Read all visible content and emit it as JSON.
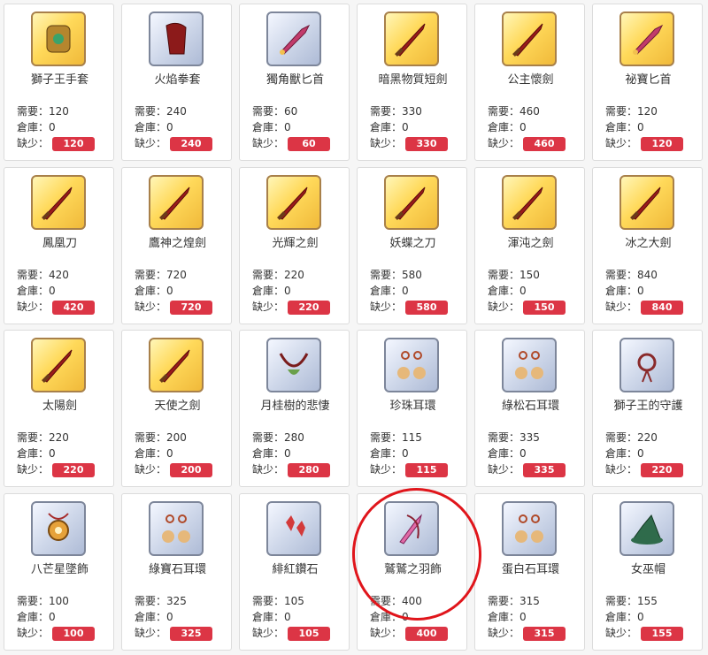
{
  "labels": {
    "need": "需要：",
    "stock": "倉庫：",
    "lack": "缺少："
  },
  "colors": {
    "badge": "#dc3545",
    "annotation": "#e0151b"
  },
  "items": [
    {
      "name": "獅子王手套",
      "need": "120",
      "stock": "0",
      "lack": "120",
      "frame": "gold",
      "icon": "glove-icon"
    },
    {
      "name": "火焰拳套",
      "need": "240",
      "stock": "0",
      "lack": "240",
      "frame": "silver",
      "icon": "gauntlet-icon"
    },
    {
      "name": "獨角獸匕首",
      "need": "60",
      "stock": "0",
      "lack": "60",
      "frame": "silver",
      "icon": "dagger-icon"
    },
    {
      "name": "暗黑物質短劍",
      "need": "330",
      "stock": "0",
      "lack": "330",
      "frame": "gold",
      "icon": "sword-icon"
    },
    {
      "name": "公主懷劍",
      "need": "460",
      "stock": "0",
      "lack": "460",
      "frame": "gold",
      "icon": "sword-icon"
    },
    {
      "name": "祕寶匕首",
      "need": "120",
      "stock": "0",
      "lack": "120",
      "frame": "gold",
      "icon": "dagger-icon"
    },
    {
      "name": "鳳凰刀",
      "need": "420",
      "stock": "0",
      "lack": "420",
      "frame": "gold",
      "icon": "sword-icon"
    },
    {
      "name": "鷹神之煌劍",
      "need": "720",
      "stock": "0",
      "lack": "720",
      "frame": "gold",
      "icon": "sword-icon"
    },
    {
      "name": "光輝之劍",
      "need": "220",
      "stock": "0",
      "lack": "220",
      "frame": "gold",
      "icon": "sword-icon"
    },
    {
      "name": "妖蝶之刀",
      "need": "580",
      "stock": "0",
      "lack": "580",
      "frame": "gold",
      "icon": "sword-icon"
    },
    {
      "name": "渾沌之劍",
      "need": "150",
      "stock": "0",
      "lack": "150",
      "frame": "gold",
      "icon": "sword-icon"
    },
    {
      "name": "冰之大劍",
      "need": "840",
      "stock": "0",
      "lack": "840",
      "frame": "gold",
      "icon": "sword-icon"
    },
    {
      "name": "太陽劍",
      "need": "220",
      "stock": "0",
      "lack": "220",
      "frame": "gold",
      "icon": "sword-icon"
    },
    {
      "name": "天使之劍",
      "need": "200",
      "stock": "0",
      "lack": "200",
      "frame": "gold",
      "icon": "sword-icon"
    },
    {
      "name": "月桂樹的悲悽",
      "need": "280",
      "stock": "0",
      "lack": "280",
      "frame": "silver",
      "icon": "necklace-icon"
    },
    {
      "name": "珍珠耳環",
      "need": "115",
      "stock": "0",
      "lack": "115",
      "frame": "silver",
      "icon": "earring-icon"
    },
    {
      "name": "綠松石耳環",
      "need": "335",
      "stock": "0",
      "lack": "335",
      "frame": "silver",
      "icon": "earring-icon"
    },
    {
      "name": "獅子王的守護",
      "need": "220",
      "stock": "0",
      "lack": "220",
      "frame": "silver",
      "icon": "amulet-icon"
    },
    {
      "name": "八芒星墜飾",
      "need": "100",
      "stock": "0",
      "lack": "100",
      "frame": "silver",
      "icon": "pendant-icon"
    },
    {
      "name": "綠寶石耳環",
      "need": "325",
      "stock": "0",
      "lack": "325",
      "frame": "silver",
      "icon": "earring-icon"
    },
    {
      "name": "緋紅鑽石",
      "need": "105",
      "stock": "0",
      "lack": "105",
      "frame": "silver",
      "icon": "gem-icon"
    },
    {
      "name": "鷲鷲之羽飾",
      "need": "400",
      "stock": "0",
      "lack": "400",
      "frame": "silver",
      "icon": "feather-icon"
    },
    {
      "name": "蛋白石耳環",
      "need": "315",
      "stock": "0",
      "lack": "315",
      "frame": "silver",
      "icon": "earring-icon"
    },
    {
      "name": "女巫帽",
      "need": "155",
      "stock": "0",
      "lack": "155",
      "frame": "silver",
      "icon": "witch-hat-icon"
    }
  ]
}
